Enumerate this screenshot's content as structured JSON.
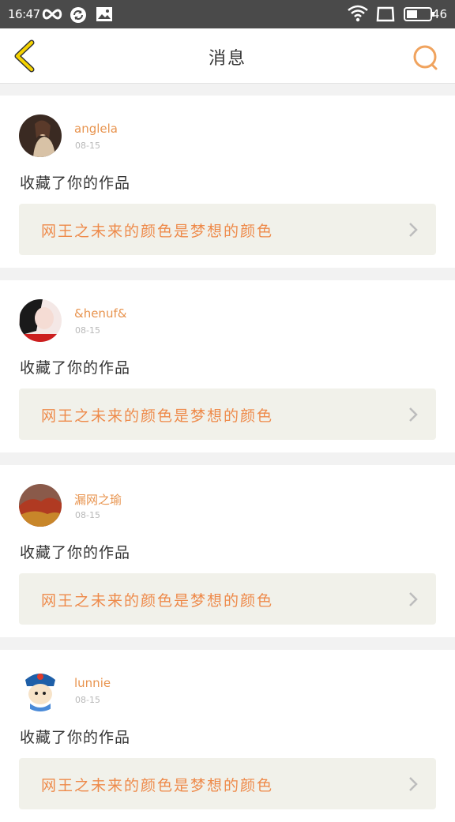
{
  "status_bar": {
    "time": "16:47",
    "battery": "46",
    "icons": [
      "infinity-icon",
      "sync-icon",
      "image-icon",
      "wifi-icon",
      "screen-icon",
      "battery-icon"
    ]
  },
  "header": {
    "title": "消息",
    "back_icon": "chevron-left-icon",
    "search_icon": "search-icon",
    "accent_color": "#f5b800",
    "search_color": "#f0a35e"
  },
  "messages": [
    {
      "username": "anglela",
      "date": "08-15",
      "action": "收藏了你的作品",
      "work_title": "网王之未来的颜色是梦想的颜色"
    },
    {
      "username": "&henuf&",
      "date": "08-15",
      "action": "收藏了你的作品",
      "work_title": "网王之未来的颜色是梦想的颜色"
    },
    {
      "username": "漏网之瑜",
      "date": "08-15",
      "action": "收藏了你的作品",
      "work_title": "网王之未来的颜色是梦想的颜色"
    },
    {
      "username": "lunnie",
      "date": "08-15",
      "action": "收藏了你的作品",
      "work_title": "网王之未来的颜色是梦想的颜色"
    }
  ],
  "colors": {
    "username": "#e8944f",
    "work_title": "#ee8a4a",
    "work_bg": "#f1f1ea",
    "page_bg": "#f2f2f2"
  }
}
